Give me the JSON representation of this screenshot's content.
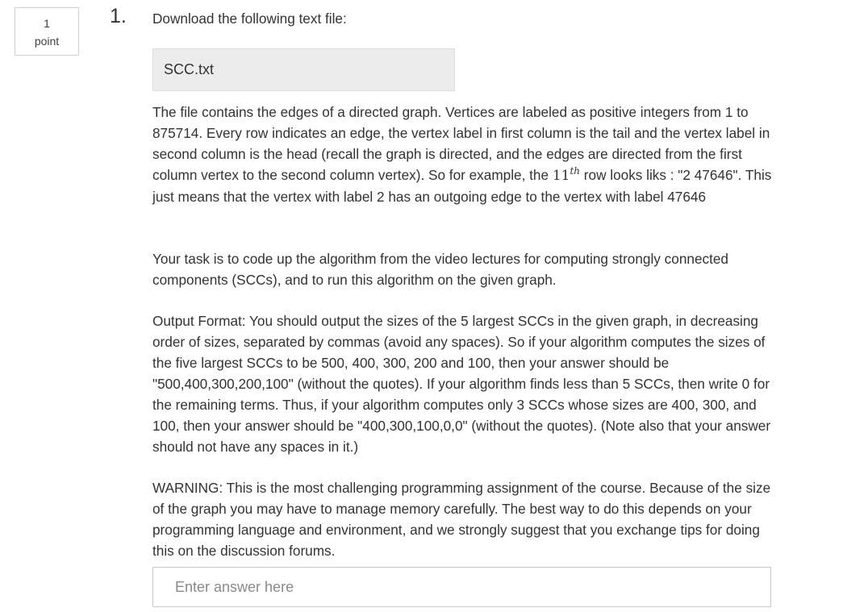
{
  "question": {
    "points_value": "1",
    "points_label": "point",
    "number": "1.",
    "intro": "Download the following text file:",
    "file_link": "SCC.txt",
    "paragraph1": {
      "before_math": "The file contains the edges of a directed graph. Vertices are labeled as positive integers from 1 to 875714. Every row indicates an edge, the vertex label in first column is the tail and the vertex label in second column is the head (recall the graph is directed, and the edges are directed from the first column vertex to the second column vertex). So for example, the ",
      "math_base": "11",
      "math_sup": "th",
      "after_math": " row looks liks : \"2 47646\". This just means that the vertex with label 2 has an outgoing edge to the vertex with label 47646"
    },
    "paragraph2": "Your task is to code up the algorithm from the video lectures for computing strongly connected components (SCCs), and to run this algorithm on the given graph.",
    "paragraph3": "Output Format: You should output the sizes of the 5 largest SCCs in the given graph, in decreasing order of sizes, separated by commas (avoid any spaces). So if your algorithm computes the sizes of the five largest SCCs to be 500, 400, 300, 200 and 100, then your answer should be \"500,400,300,200,100\" (without the quotes). If your algorithm finds less than 5 SCCs, then write 0 for the remaining terms. Thus, if your algorithm computes only 3 SCCs whose sizes are 400, 300, and 100, then your answer should be \"400,300,100,0,0\" (without the quotes). (Note also that your answer should not have any spaces in it.)",
    "paragraph4": "WARNING: This is the most challenging programming assignment of the course. Because of the size of the graph you may have to manage memory carefully. The best way to do this depends on your programming language and environment, and we strongly suggest that you exchange tips for doing this on the discussion forums.",
    "answer": {
      "value": "",
      "placeholder": "Enter answer here"
    }
  }
}
